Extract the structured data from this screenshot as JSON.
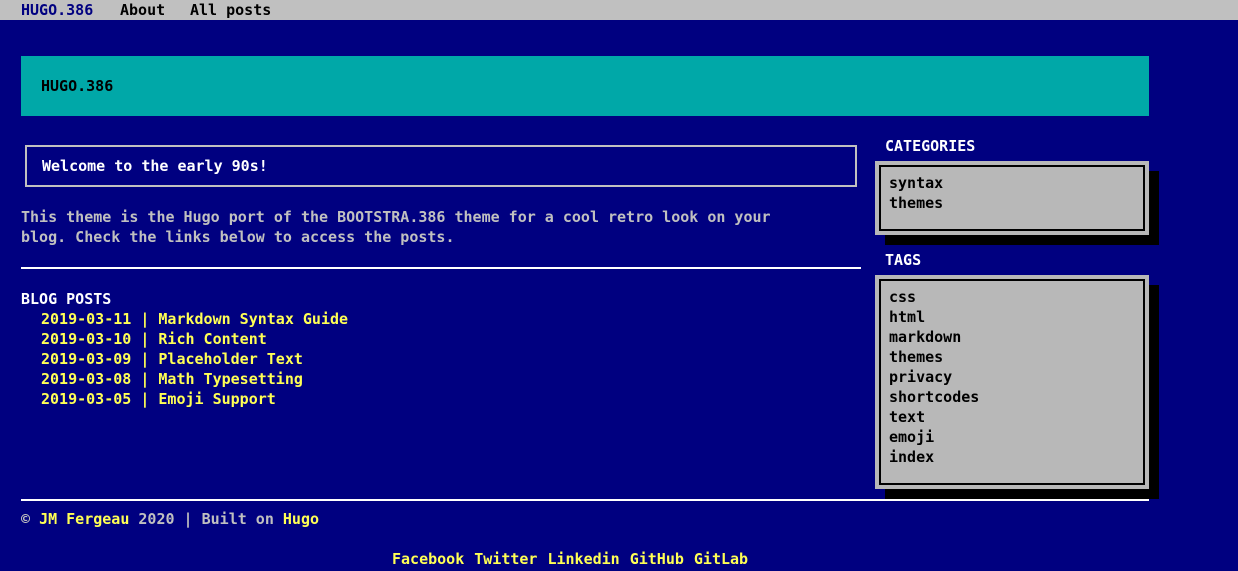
{
  "nav": {
    "brand": "HUGO.386",
    "items": [
      "About",
      "All posts"
    ]
  },
  "jumbotron": {
    "title": "HUGO.386"
  },
  "welcome": {
    "text": "Welcome to the early 90s!"
  },
  "intro": {
    "lines": [
      "This theme is the Hugo port of the BOOTSTRA.386 theme for a cool retro look on your",
      "blog. Check the links below to access the posts."
    ]
  },
  "blog": {
    "heading": "BLOG POSTS",
    "posts": [
      {
        "date": "2019-03-11",
        "separator": "|",
        "title": "Markdown Syntax Guide"
      },
      {
        "date": "2019-03-10",
        "separator": "|",
        "title": "Rich Content"
      },
      {
        "date": "2019-03-09",
        "separator": "|",
        "title": "Placeholder Text"
      },
      {
        "date": "2019-03-08",
        "separator": "|",
        "title": "Math Typesetting"
      },
      {
        "date": "2019-03-05",
        "separator": "|",
        "title": "Emoji Support"
      }
    ]
  },
  "sidebar": {
    "categories": {
      "heading": "CATEGORIES",
      "items": [
        "syntax",
        "themes"
      ]
    },
    "tags": {
      "heading": "TAGS",
      "items": [
        "css",
        "html",
        "markdown",
        "themes",
        "privacy",
        "shortcodes",
        "text",
        "emoji",
        "index"
      ]
    }
  },
  "footer": {
    "copyright": "©",
    "author": "JM Fergeau",
    "year_text": "2020 | Built on",
    "built_on": "Hugo",
    "social": [
      "Facebook",
      "Twitter",
      "Linkedin",
      "GitHub",
      "GitLab"
    ]
  },
  "colors": {
    "background": "#000080",
    "navbar": "#c0c0c0",
    "jumbotron": "#00a8a8",
    "link": "#ffff54",
    "panel": "#b8b8b8"
  }
}
